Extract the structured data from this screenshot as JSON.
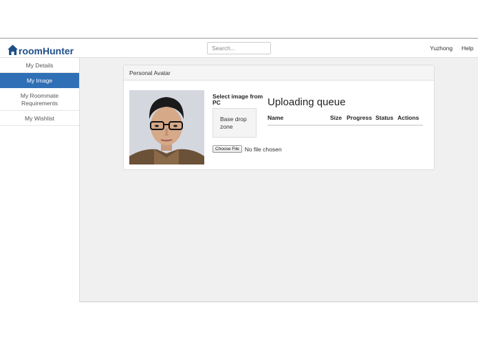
{
  "brand": {
    "name": "roomHunter"
  },
  "search": {
    "placeholder": "Search..."
  },
  "nav": {
    "user": "Yuzhong",
    "help": "Help"
  },
  "sidebar": {
    "items": [
      {
        "label": "My Details",
        "active": false
      },
      {
        "label": "My Image",
        "active": true
      },
      {
        "label": "My Roommate Requirements",
        "active": false
      },
      {
        "label": "My Wishlist",
        "active": false
      }
    ]
  },
  "panel": {
    "title": "Personal Avatar",
    "select_label": "Select image from PC",
    "dropzone_label": "Base drop zone",
    "file_button": "Choose File",
    "file_status": "No file chosen"
  },
  "queue": {
    "title": "Uploading queue",
    "columns": [
      "Name",
      "Size",
      "Progress",
      "Status",
      "Actions"
    ]
  },
  "colors": {
    "accent": "#2f6fb5",
    "brand": "#1f4f8a"
  }
}
